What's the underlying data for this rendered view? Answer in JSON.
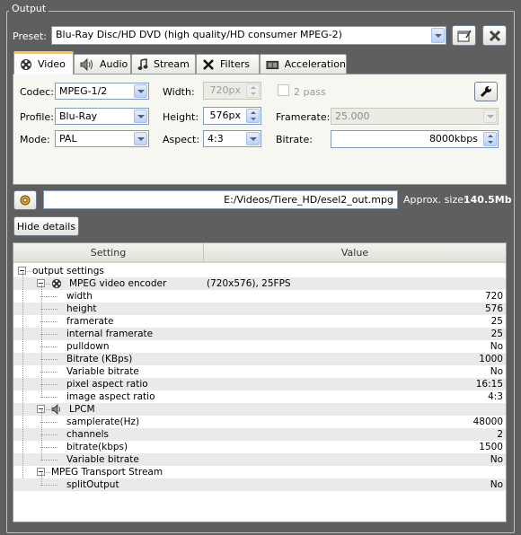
{
  "group_title": "Output",
  "preset": {
    "label": "Preset:",
    "value": "Blu-Ray Disc/HD DVD (high quality/HD consumer MPEG-2)"
  },
  "tabs": [
    {
      "label": "Video",
      "icon": "film-reel-icon"
    },
    {
      "label": "Audio",
      "icon": "speaker-icon"
    },
    {
      "label": "Stream",
      "icon": "music-note-icon"
    },
    {
      "label": "Filters",
      "icon": "scissors-icon"
    },
    {
      "label": "Acceleration",
      "icon": "graphics-card-icon"
    }
  ],
  "video": {
    "codec_label": "Codec:",
    "codec_value": "MPEG-1/2",
    "profile_label": "Profile:",
    "profile_value": "Blu-Ray",
    "mode_label": "Mode:",
    "mode_value": "PAL",
    "width_label": "Width:",
    "width_value": "720px",
    "height_label": "Height:",
    "height_value": "576px",
    "aspect_label": "Aspect:",
    "aspect_value": "4:3",
    "twopass_label": "2 pass",
    "twopass_checked": false,
    "framerate_label": "Framerate:",
    "framerate_value": "25.000",
    "bitrate_label": "Bitrate:",
    "bitrate_value": "8000kbps"
  },
  "output_path": "E:/Videos/Tiere_HD/esel2_out.mpg",
  "approx_size_label": "Approx. size:",
  "approx_size_value": "140.5Mb",
  "hide_details_label": "Hide details",
  "details": {
    "columns": [
      "Setting",
      "Value"
    ],
    "rows": [
      {
        "name": "output settings",
        "value": "",
        "level": 0,
        "expander": true,
        "alt": false
      },
      {
        "name": "MPEG video encoder",
        "value": "(720x576), 25FPS",
        "level": 1,
        "expander": true,
        "icon": "film-reel-icon",
        "alt": true,
        "mid": true
      },
      {
        "name": "width",
        "value": "720",
        "level": 2,
        "alt": false
      },
      {
        "name": "height",
        "value": "576",
        "level": 2,
        "alt": true
      },
      {
        "name": "framerate",
        "value": "25",
        "level": 2,
        "alt": false
      },
      {
        "name": "internal framerate",
        "value": "25",
        "level": 2,
        "alt": true
      },
      {
        "name": "pulldown",
        "value": "No",
        "level": 2,
        "alt": false
      },
      {
        "name": "Bitrate (KBps)",
        "value": "1000",
        "level": 2,
        "alt": true
      },
      {
        "name": "Variable bitrate",
        "value": "No",
        "level": 2,
        "alt": false
      },
      {
        "name": "pixel aspect ratio",
        "value": "16:15",
        "level": 2,
        "alt": true
      },
      {
        "name": "image aspect ratio",
        "value": "4:3",
        "level": 2,
        "alt": false
      },
      {
        "name": "LPCM",
        "value": "",
        "level": 1,
        "expander": true,
        "icon": "speaker-icon",
        "alt": true
      },
      {
        "name": "samplerate(Hz)",
        "value": "48000",
        "level": 2,
        "alt": false
      },
      {
        "name": "channels",
        "value": "2",
        "level": 2,
        "alt": true
      },
      {
        "name": "bitrate(kbps)",
        "value": "1500",
        "level": 2,
        "alt": false
      },
      {
        "name": "Variable bitrate",
        "value": "No",
        "level": 2,
        "alt": true
      },
      {
        "name": "MPEG Transport Stream",
        "value": "",
        "level": 1,
        "expander": true,
        "alt": false
      },
      {
        "name": "splitOutput",
        "value": "No",
        "level": 2,
        "alt": true
      }
    ]
  }
}
